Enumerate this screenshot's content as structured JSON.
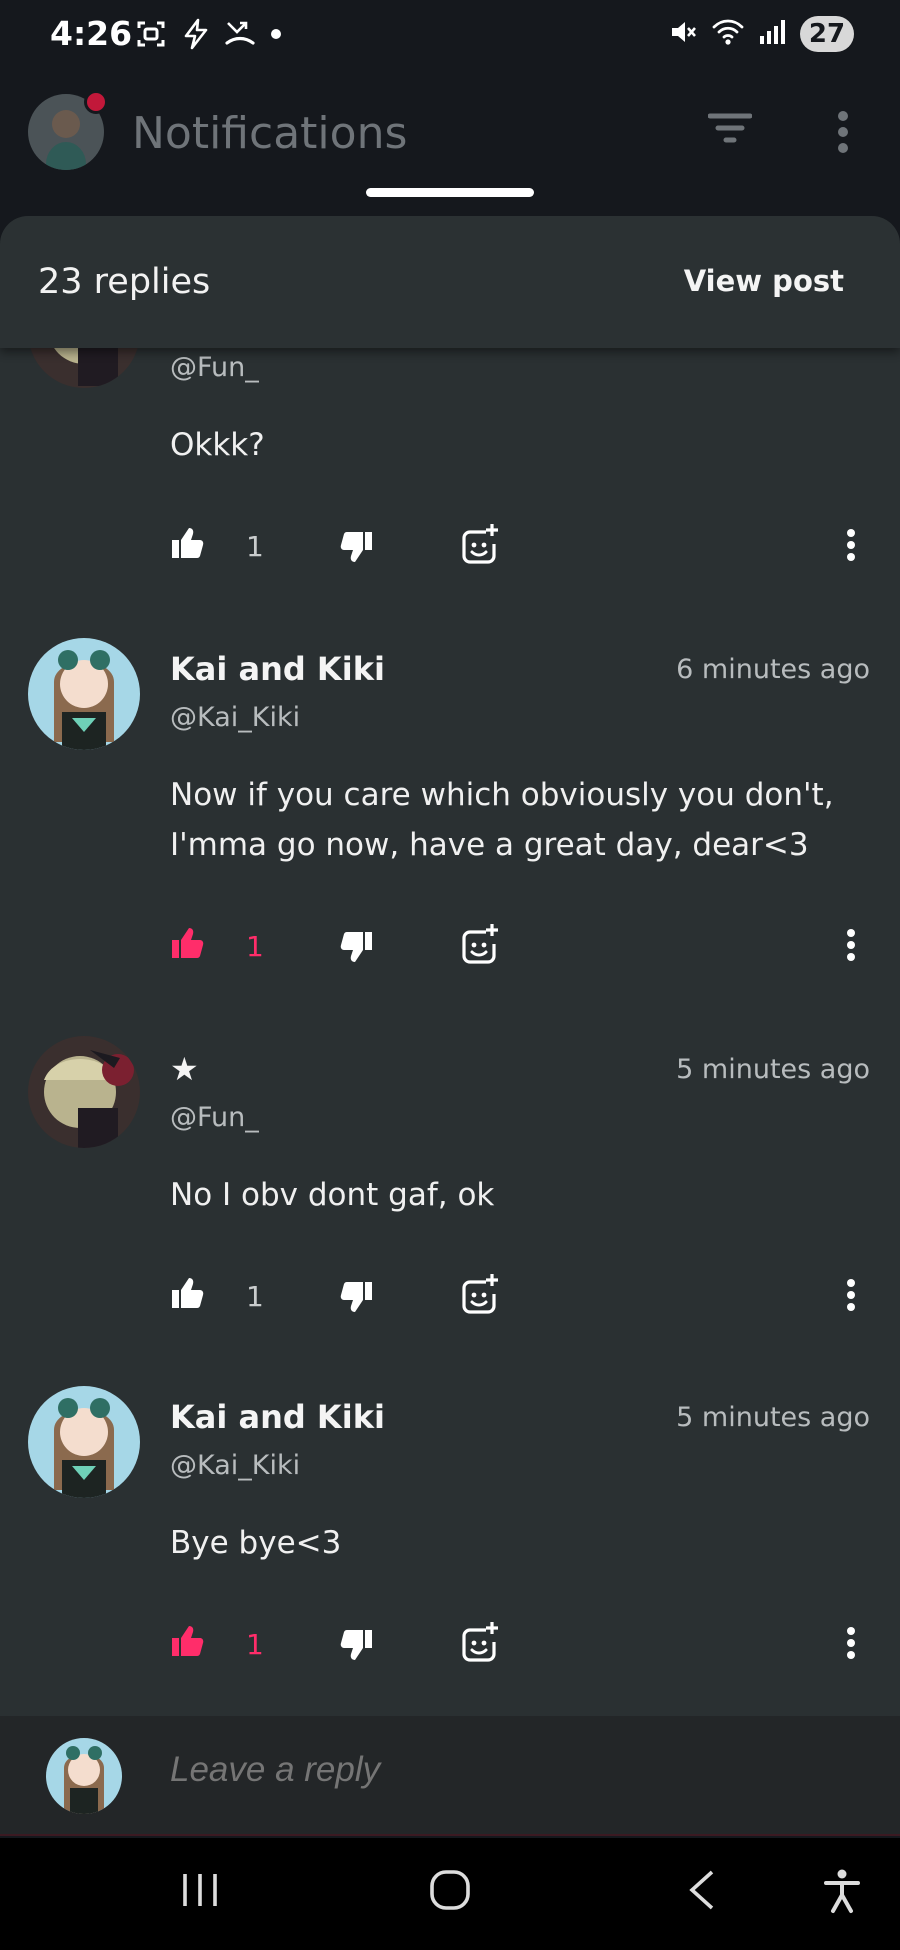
{
  "status_bar": {
    "time": "4:26",
    "battery": "27"
  },
  "header": {
    "title": "Notifications"
  },
  "sheet": {
    "replies_count": "23 replies",
    "view_post": "View post"
  },
  "comments": [
    {
      "name": "",
      "handle": "@Fun_",
      "time": "",
      "text": "Okkk?",
      "likes": "1",
      "liked": false
    },
    {
      "name": "Kai and Kiki",
      "handle": "@Kai_Kiki",
      "time": "6 minutes ago",
      "text": "Now if you care which obviously you don't, I'mma go now, have a great day, dear<3",
      "likes": "1",
      "liked": true
    },
    {
      "name": "★",
      "handle": "@Fun_",
      "time": "5 minutes ago",
      "text": "No I obv dont gaf, ok",
      "likes": "1",
      "liked": false
    },
    {
      "name": "Kai and Kiki",
      "handle": "@Kai_Kiki",
      "time": "5 minutes ago",
      "text": "Bye bye<3",
      "likes": "1",
      "liked": true
    }
  ],
  "reply_bar": {
    "placeholder": "Leave a reply"
  },
  "colors": {
    "accent": "#ff2d6a",
    "sheet_bg": "#2a3032",
    "header_bg": "#15181d"
  }
}
